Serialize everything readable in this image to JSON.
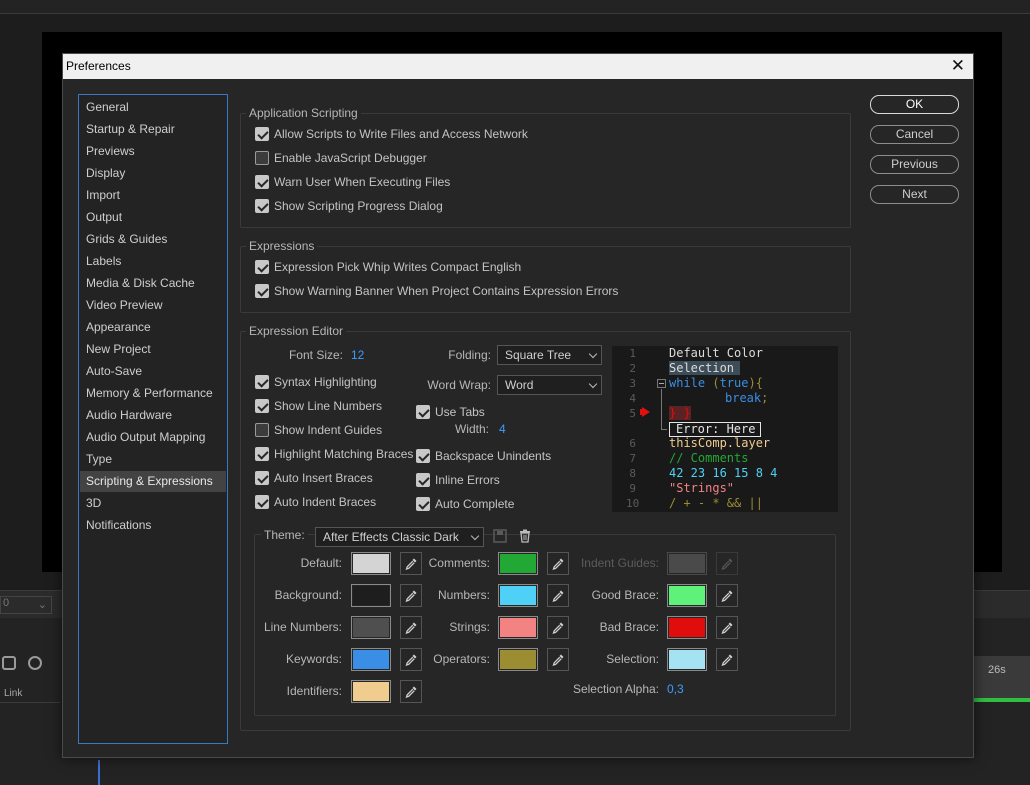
{
  "dialog": {
    "title": "Preferences",
    "close_glyph": "✕"
  },
  "background": {
    "dropdown_value": "0",
    "link_label": "Link",
    "time_label": "26s"
  },
  "sidebar": {
    "items": [
      {
        "label": "General"
      },
      {
        "label": "Startup & Repair"
      },
      {
        "label": "Previews"
      },
      {
        "label": "Display"
      },
      {
        "label": "Import"
      },
      {
        "label": "Output"
      },
      {
        "label": "Grids & Guides"
      },
      {
        "label": "Labels"
      },
      {
        "label": "Media & Disk Cache"
      },
      {
        "label": "Video Preview"
      },
      {
        "label": "Appearance"
      },
      {
        "label": "New Project"
      },
      {
        "label": "Auto-Save"
      },
      {
        "label": "Memory & Performance"
      },
      {
        "label": "Audio Hardware"
      },
      {
        "label": "Audio Output Mapping"
      },
      {
        "label": "Type"
      },
      {
        "label": "Scripting & Expressions"
      },
      {
        "label": "3D"
      },
      {
        "label": "Notifications"
      }
    ],
    "selected": "Scripting & Expressions"
  },
  "buttons": {
    "ok": "OK",
    "cancel": "Cancel",
    "previous": "Previous",
    "next": "Next"
  },
  "app_scripting": {
    "title": "Application Scripting",
    "options": [
      {
        "label": "Allow Scripts to Write Files and Access Network",
        "checked": true
      },
      {
        "label": "Enable JavaScript Debugger",
        "checked": false
      },
      {
        "label": "Warn User When Executing Files",
        "checked": true
      },
      {
        "label": "Show Scripting Progress Dialog",
        "checked": true
      }
    ]
  },
  "expressions": {
    "title": "Expressions",
    "options": [
      {
        "label": "Expression Pick Whip Writes Compact English",
        "checked": true
      },
      {
        "label": "Show Warning Banner When Project Contains Expression Errors",
        "checked": true
      }
    ]
  },
  "editor": {
    "title": "Expression Editor",
    "font_size_label": "Font Size:",
    "font_size_value": "12",
    "folding_label": "Folding:",
    "folding_value": "Square Tree",
    "word_wrap_label": "Word Wrap:",
    "word_wrap_value": "Word",
    "use_tabs": {
      "label": "Use Tabs",
      "checked": true
    },
    "width_label": "Width:",
    "width_value": "4",
    "left_options": [
      {
        "label": "Syntax Highlighting",
        "checked": true
      },
      {
        "label": "Show Line Numbers",
        "checked": true
      },
      {
        "label": "Show Indent Guides",
        "checked": false
      },
      {
        "label": "Highlight Matching Braces",
        "checked": true
      },
      {
        "label": "Auto Insert Braces",
        "checked": true
      },
      {
        "label": "Auto Indent Braces",
        "checked": true
      }
    ],
    "right_options": [
      {
        "label": "Backspace Unindents",
        "checked": true
      },
      {
        "label": "Inline Errors",
        "checked": true
      },
      {
        "label": "Auto Complete",
        "checked": true
      }
    ]
  },
  "preview": {
    "line_numbers": [
      "1",
      "2",
      "3",
      "4",
      "5",
      "6",
      "7",
      "8",
      "9",
      "10"
    ],
    "line1": "Default Color",
    "line2": "Selection",
    "line3_kw": "while",
    "line3_op1": " (",
    "line3_true": "true",
    "line3_op2": "){",
    "line4_kw": "break",
    "line4_op": ";",
    "line5": "} }",
    "error_text": "Error: Here",
    "line6": "thisComp.layer",
    "line7": "// Comments",
    "line8": "42 23 16 15 8 4",
    "line9": "\"Strings\"",
    "line10": "/ + - * && ||"
  },
  "theme": {
    "label": "Theme:",
    "value": "After Effects Classic Dark",
    "selection_alpha_label": "Selection Alpha:",
    "selection_alpha_value": "0,3",
    "colors": {
      "default": {
        "label": "Default:",
        "color": "#d4d4d4"
      },
      "background": {
        "label": "Background:",
        "color": "#1e1e1e"
      },
      "line_numbers": {
        "label": "Line Numbers:",
        "color": "#4f4f4f"
      },
      "keywords": {
        "label": "Keywords:",
        "color": "#3a8ee6"
      },
      "identifiers": {
        "label": "Identifiers:",
        "color": "#f0cd8f"
      },
      "comments": {
        "label": "Comments:",
        "color": "#22a834"
      },
      "numbers": {
        "label": "Numbers:",
        "color": "#4fd1f7"
      },
      "strings": {
        "label": "Strings:",
        "color": "#f38383"
      },
      "operators": {
        "label": "Operators:",
        "color": "#9c8d32"
      },
      "indent_guides": {
        "label": "Indent Guides:",
        "color": "#4a4a4a"
      },
      "good_brace": {
        "label": "Good Brace:",
        "color": "#5ef27a"
      },
      "bad_brace": {
        "label": "Bad Brace:",
        "color": "#e00d0d"
      },
      "selection": {
        "label": "Selection:",
        "color": "#a6e3f2"
      }
    }
  },
  "code_colors": {
    "default": "#dcdcdc",
    "keyword": "#3a8ee6",
    "number": "#4fd1f7",
    "string": "#f38383",
    "comment": "#22a834",
    "operator": "#9c8d32",
    "identifier": "#f0cd8f",
    "bad_brace": "#e00d0d"
  },
  "icons": [
    "close-icon",
    "chevron-down-icon",
    "eyedropper-icon",
    "trash-icon",
    "save-theme-icon",
    "breakpoint-arrow-icon",
    "fold-minus-icon"
  ]
}
